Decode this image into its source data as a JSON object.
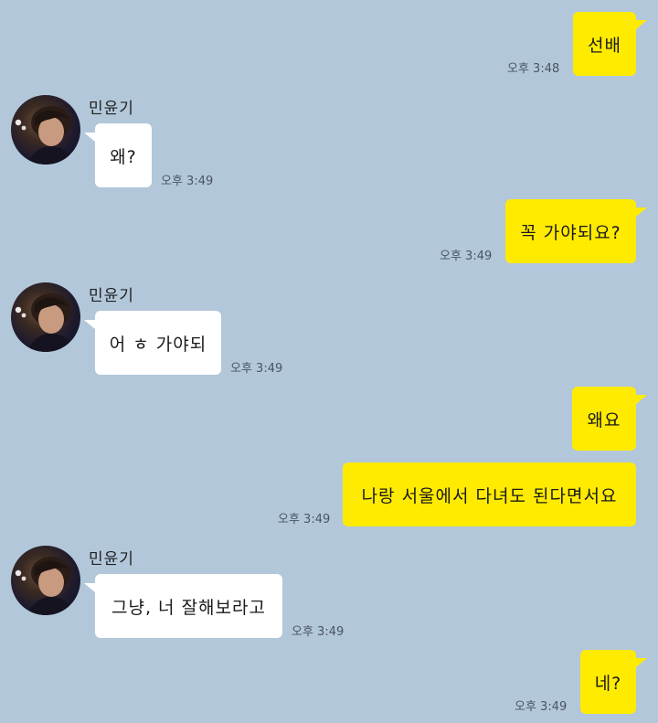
{
  "chat": {
    "contact_name": "민윤기",
    "colors": {
      "background": "#b2c7da",
      "my_bubble": "#ffeb00",
      "their_bubble": "#ffffff",
      "time_text": "#4a5563"
    },
    "messages": [
      {
        "sender": "me",
        "text": "선배",
        "time": "오후 3:48"
      },
      {
        "sender": "them",
        "name": "민윤기",
        "text": "왜?",
        "time": "오후 3:49"
      },
      {
        "sender": "me",
        "text": "꼭 가야되요?",
        "time": "오후 3:49"
      },
      {
        "sender": "them",
        "name": "민윤기",
        "text": "어 ㅎ 가야되",
        "time": "오후 3:49"
      },
      {
        "sender": "me",
        "text": "왜요",
        "time": ""
      },
      {
        "sender": "me",
        "text": "나랑 서울에서 다녀도 된다면서요",
        "time": "오후 3:49"
      },
      {
        "sender": "them",
        "name": "민윤기",
        "text": "그냥, 너 잘해보라고",
        "time": "오후 3:49"
      },
      {
        "sender": "me",
        "text": "네?",
        "time": "오후 3:49"
      }
    ]
  }
}
